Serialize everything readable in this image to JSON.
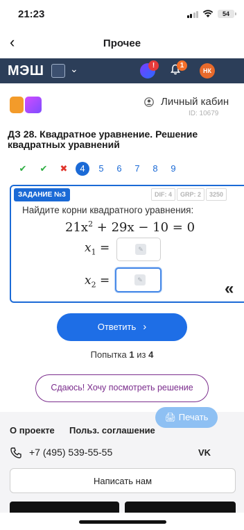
{
  "status_bar": {
    "time": "21:23",
    "battery": "54"
  },
  "nav": {
    "title": "Прочее"
  },
  "app_bar": {
    "logo": "МЭШ",
    "ai_badge": "!",
    "notifications_count": "1",
    "avatar_initials": "НК"
  },
  "header": {
    "user_link": "Личный кабин",
    "user_id": "ID: 10679"
  },
  "task_title": "ДЗ 28. Квадратное уравнение. Решение квадратных уравнений",
  "steps": [
    {
      "label": "✔",
      "state": "correct"
    },
    {
      "label": "✔",
      "state": "correct"
    },
    {
      "label": "✖",
      "state": "wrong"
    },
    {
      "label": "4",
      "state": "current"
    },
    {
      "label": "5",
      "state": "pending"
    },
    {
      "label": "6",
      "state": "pending"
    },
    {
      "label": "7",
      "state": "pending"
    },
    {
      "label": "8",
      "state": "pending"
    },
    {
      "label": "9",
      "state": "pending"
    }
  ],
  "task": {
    "label": "ЗАДАНИЕ №3",
    "meta": [
      "DIF: 4",
      "GRP: 2",
      "3250"
    ],
    "text": "Найдите корни квадратного уравнения:",
    "equation_before": "21x",
    "equation_power": "2",
    "equation_after": " + 29x − 10 = 0",
    "answers": [
      {
        "var": "x",
        "sub": "1",
        "value": ""
      },
      {
        "var": "x",
        "sub": "2",
        "value": ""
      }
    ]
  },
  "actions": {
    "answer": "Ответить",
    "attempt_prefix": "Попытка",
    "attempt_current": "1",
    "attempt_of": "из",
    "attempt_total": "4",
    "give_up": "Сдаюсь! Хочу посмотреть решение"
  },
  "footer": {
    "print": "Печать",
    "about": "О проекте",
    "agreement": "Польз. соглашение",
    "phone": "+7 (495) 539-55-55",
    "write_us": "Написать нам",
    "social": "VK"
  },
  "colors": {
    "primary": "#1e6ee6",
    "app_bar": "#2c3e59",
    "give_up": "#7a2c8c",
    "correct": "#2fae43",
    "wrong": "#e0342b"
  }
}
